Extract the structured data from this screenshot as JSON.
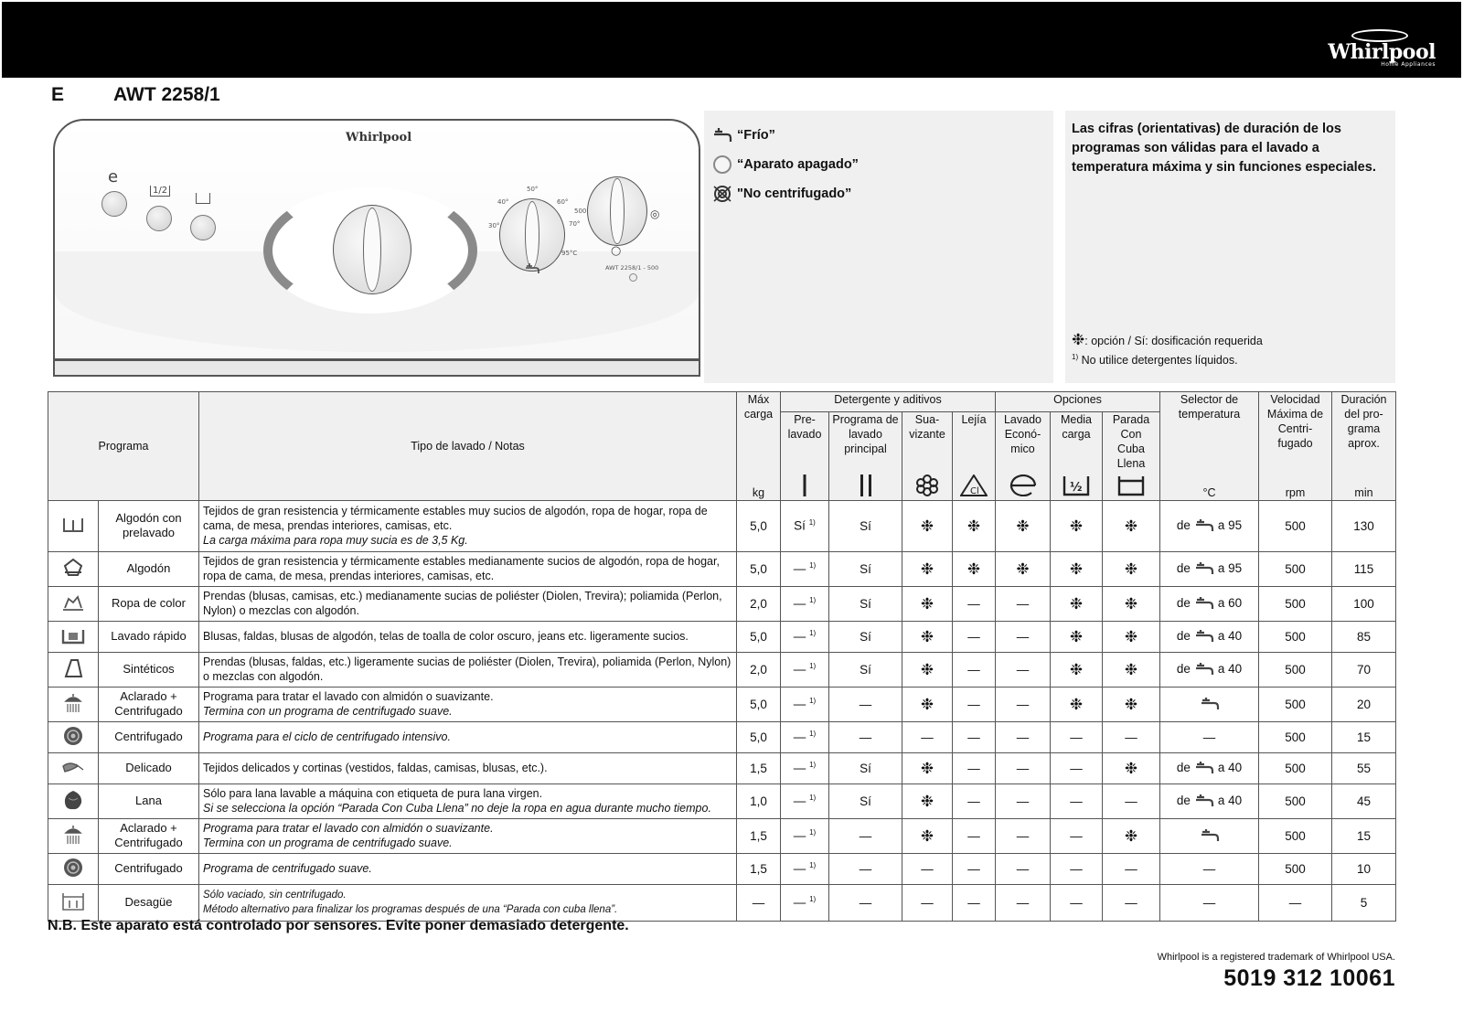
{
  "header": {
    "brand_name": "Whirlpool",
    "brand_sub": "Home Appliances",
    "language_code": "E",
    "model": "AWT 2258/1"
  },
  "control_panel": {
    "logo": "Whirlpool",
    "button_symbols": [
      "e",
      "1/2",
      "⊔"
    ],
    "temp_ticks": [
      "30°",
      "40°",
      "50°",
      "60°",
      "70°",
      "95°C"
    ],
    "spin_ticks": [
      "500"
    ],
    "model_label": "AWT 2258/1 - 500"
  },
  "legend": {
    "items": [
      {
        "icon": "cold-tap-icon",
        "label": "“Frío”"
      },
      {
        "icon": "off-circle-icon",
        "label": "“Aparato apagado”"
      },
      {
        "icon": "no-spin-icon",
        "label": "\"No centrifugado”"
      }
    ]
  },
  "notes": {
    "main": "Las cifras (orientativas) de duración de los programas son válidas para el lavado a temperatura máxima y sin funciones especiales.",
    "option_note": ": opción / Sí: dosificación requerida",
    "footnote_mark": "1)",
    "footnote": "No utilice detergentes líquidos."
  },
  "table": {
    "headers": {
      "programa": "Programa",
      "tipo": "Tipo de lavado / Notas",
      "max_carga": "Máx carga",
      "max_carga_unit": "kg",
      "detergente_group": "Detergente y aditivos",
      "prelavado": "Pre-lavado",
      "principal": "Programa de lavado principal",
      "suavizante": "Sua-vizante",
      "lejia": "Lejía",
      "opciones_group": "Opciones",
      "economico": "Lavado Econó-mico",
      "media_carga": "Media carga",
      "parada": "Parada Con Cuba Llena",
      "selector": "Selector de temperatura",
      "selector_unit": "°C",
      "velocidad": "Velocidad Máxima de Centri-fugado",
      "velocidad_unit": "rpm",
      "duracion": "Duración del pro-grama aprox.",
      "duracion_unit": "min"
    },
    "rows": [
      {
        "icon": "prewash-tub-icon",
        "name": "Algodón con prelavado",
        "desc": "Tejidos de gran resistencia y térmicamente estables muy sucios de algodón, ropa de hogar, ropa de cama, de mesa, prendas interiores, camisas, etc.",
        "desc_it": "La carga máxima para ropa muy sucia es de 3,5 Kg.",
        "carga": "5,0",
        "prelavado": "Sí",
        "principal": "Sí",
        "suavizante": "❉",
        "lejia": "❉",
        "economico": "❉",
        "media": "❉",
        "parada": "❉",
        "temp_from": "de",
        "temp_to": "a 95",
        "temp_tap": true,
        "rpm": "500",
        "min": "130"
      },
      {
        "icon": "cotton-icon",
        "name": "Algodón",
        "desc": "Tejidos de gran resistencia y térmicamente estables medianamente sucios de algodón, ropa de hogar, ropa de cama, de mesa, prendas interiores, camisas, etc.",
        "desc_it": "",
        "carga": "5,0",
        "prelavado": "—",
        "principal": "Sí",
        "suavizante": "❉",
        "lejia": "❉",
        "economico": "❉",
        "media": "❉",
        "parada": "❉",
        "temp_from": "de",
        "temp_to": "a 95",
        "temp_tap": true,
        "rpm": "500",
        "min": "115"
      },
      {
        "icon": "colored-icon",
        "name": "Ropa de color",
        "desc": "Prendas (blusas, camisas, etc.) medianamente sucias de poliéster (Diolen, Trevira); poliamida (Perlon, Nylon) o mezclas con algodón.",
        "desc_it": "",
        "carga": "2,0",
        "prelavado": "—",
        "principal": "Sí",
        "suavizante": "❉",
        "lejia": "—",
        "economico": "—",
        "media": "❉",
        "parada": "❉",
        "temp_from": "de",
        "temp_to": "a 60",
        "temp_tap": true,
        "rpm": "500",
        "min": "100"
      },
      {
        "icon": "rapid-wash-icon",
        "name": "Lavado rápido",
        "desc": "Blusas, faldas, blusas de algodón, telas de toalla de color oscuro, jeans etc. ligeramente sucios.",
        "desc_it": "",
        "carga": "5,0",
        "prelavado": "—",
        "principal": "Sí",
        "suavizante": "❉",
        "lejia": "—",
        "economico": "—",
        "media": "❉",
        "parada": "❉",
        "temp_from": "de",
        "temp_to": "a 40",
        "temp_tap": true,
        "rpm": "500",
        "min": "85"
      },
      {
        "icon": "synthetics-icon",
        "name": "Sintéticos",
        "desc": "Prendas (blusas, faldas, etc.) ligeramente sucias de poliéster (Diolen, Trevira), poliamida (Perlon, Nylon) o mezclas con algodón.",
        "desc_it": "",
        "carga": "2,0",
        "prelavado": "—",
        "principal": "Sí",
        "suavizante": "❉",
        "lejia": "—",
        "economico": "—",
        "media": "❉",
        "parada": "❉",
        "temp_from": "de",
        "temp_to": "a 40",
        "temp_tap": true,
        "rpm": "500",
        "min": "70"
      },
      {
        "icon": "rinse-spin-icon",
        "name": "Aclarado + Centrifugado",
        "desc": "Programa para tratar el lavado con almidón o suavizante.",
        "desc_it": "Termina con un programa de centrifugado suave.",
        "carga": "5,0",
        "prelavado": "—",
        "principal": "—",
        "suavizante": "❉",
        "lejia": "—",
        "economico": "—",
        "media": "❉",
        "parada": "❉",
        "temp_from": "",
        "temp_to": "",
        "temp_tap": true,
        "rpm": "500",
        "min": "20"
      },
      {
        "icon": "spin-icon",
        "name": "Centrifugado",
        "desc": "",
        "desc_it": "Programa para el ciclo de centrifugado intensivo.",
        "carga": "5,0",
        "prelavado": "—",
        "principal": "—",
        "suavizante": "—",
        "lejia": "—",
        "economico": "—",
        "media": "—",
        "parada": "—",
        "temp_from": "—",
        "temp_to": "",
        "temp_tap": false,
        "rpm": "500",
        "min": "15"
      },
      {
        "icon": "delicate-icon",
        "name": "Delicado",
        "desc": "Tejidos delicados y cortinas (vestidos, faldas, camisas, blusas, etc.).",
        "desc_it": "",
        "carga": "1,5",
        "prelavado": "—",
        "principal": "Sí",
        "suavizante": "❉",
        "lejia": "—",
        "economico": "—",
        "media": "—",
        "parada": "❉",
        "temp_from": "de",
        "temp_to": "a 40",
        "temp_tap": true,
        "rpm": "500",
        "min": "55"
      },
      {
        "icon": "wool-icon",
        "name": "Lana",
        "desc": "Sólo para lana lavable a máquina con etiqueta de pura lana virgen.",
        "desc_it": "Si se selecciona la opción “Parada Con Cuba Llena” no deje la ropa en agua durante mucho tiempo.",
        "carga": "1,0",
        "prelavado": "—",
        "principal": "Sí",
        "suavizante": "❉",
        "lejia": "—",
        "economico": "—",
        "media": "—",
        "parada": "—",
        "temp_from": "de",
        "temp_to": "a 40",
        "temp_tap": true,
        "rpm": "500",
        "min": "45"
      },
      {
        "icon": "rinse-spin-icon",
        "name": "Aclarado + Centrifugado",
        "desc": "",
        "desc_it": "Programa para tratar el lavado con almidón o suavizante.",
        "desc_it2": "Termina con un programa de centrifugado suave.",
        "carga": "1,5",
        "prelavado": "—",
        "principal": "—",
        "suavizante": "❉",
        "lejia": "—",
        "economico": "—",
        "media": "—",
        "parada": "❉",
        "temp_from": "",
        "temp_to": "",
        "temp_tap": true,
        "rpm": "500",
        "min": "15"
      },
      {
        "icon": "spin-icon",
        "name": "Centrifugado",
        "desc": "",
        "desc_it": "Programa de centrifugado suave.",
        "carga": "1,5",
        "prelavado": "—",
        "principal": "—",
        "suavizante": "—",
        "lejia": "—",
        "economico": "—",
        "media": "—",
        "parada": "—",
        "temp_from": "—",
        "temp_to": "",
        "temp_tap": false,
        "rpm": "500",
        "min": "10"
      },
      {
        "icon": "drain-icon",
        "name": "Desagüe",
        "desc": "",
        "desc_it": "Sólo vaciado, sin centrifugado.",
        "desc_it2": "Método alternativo para finalizar los programas después de una “Parada con cuba llena”.",
        "carga": "—",
        "prelavado": "—",
        "principal": "—",
        "suavizante": "—",
        "lejia": "—",
        "economico": "—",
        "media": "—",
        "parada": "—",
        "temp_from": "—",
        "temp_to": "",
        "temp_tap": false,
        "rpm": "—",
        "min": "5"
      }
    ],
    "prelavado_footnote": "1)"
  },
  "footer": {
    "nb": "N.B. Este aparato está controlado por sensores. Evite poner demasiado detergente.",
    "trademark": "Whirlpool is a registered trademark of Whirlpool USA.",
    "part_number": "5019 312 10061"
  }
}
